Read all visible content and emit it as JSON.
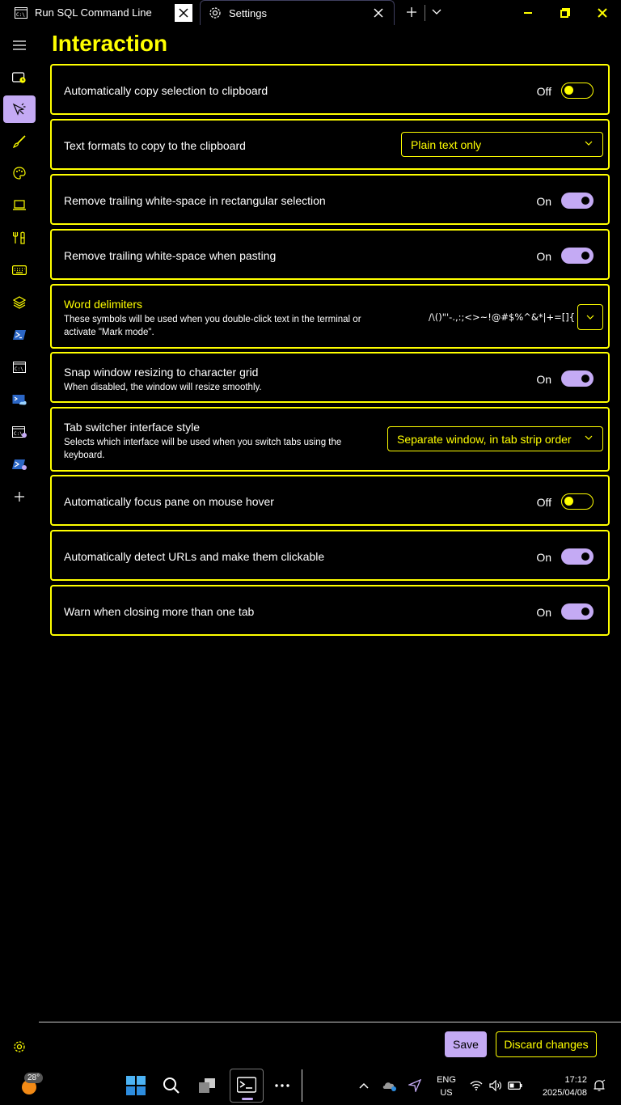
{
  "tabs": [
    {
      "title": "Run SQL Command Line",
      "icon": "cmd-icon"
    },
    {
      "title": "Settings",
      "icon": "gear-icon"
    }
  ],
  "window_controls": [
    "minimize",
    "restore",
    "close"
  ],
  "sidebar": {
    "items": [
      "menu",
      "startup",
      "interaction",
      "appearance",
      "color-schemes",
      "rendering",
      "actions",
      "keyboard",
      "layers",
      "powershell",
      "command-prompt",
      "azure-cloud-shell",
      "cmd-profile",
      "powershell-profile",
      "add-profile"
    ],
    "selected": "interaction",
    "footer": "settings"
  },
  "page": {
    "title": "Interaction"
  },
  "settings": {
    "copy_on_select": {
      "label": "Automatically copy selection to clipboard",
      "state": "Off"
    },
    "copy_formats": {
      "label": "Text formats to copy to the clipboard",
      "value": "Plain text only"
    },
    "trim_block": {
      "label": "Remove trailing white-space in rectangular selection",
      "state": "On"
    },
    "trim_paste": {
      "label": "Remove trailing white-space when pasting",
      "state": "On"
    },
    "word_delimiters": {
      "label": "Word delimiters",
      "desc": "These symbols will be used when you double-click text in the terminal or activate \"Mark mode\".",
      "value": "/\\()\"'-.,:;<>~!@#$%^&*|+=[]{}~?│"
    },
    "snap_resize": {
      "label": "Snap window resizing to character grid",
      "desc": "When disabled, the window will resize smoothly.",
      "state": "On"
    },
    "tab_switcher": {
      "label": "Tab switcher interface style",
      "desc": "Selects which interface will be used when you switch tabs using the keyboard.",
      "value": "Separate window, in tab strip order"
    },
    "focus_follow_mouse": {
      "label": "Automatically focus pane on mouse hover",
      "state": "Off"
    },
    "detect_urls": {
      "label": "Automatically detect URLs and make them clickable",
      "state": "On"
    },
    "confirm_close": {
      "label": "Warn when closing more than one tab",
      "state": "On"
    }
  },
  "actions": {
    "save": "Save",
    "discard": "Discard changes"
  },
  "taskbar": {
    "weather_temp": "28°",
    "lang_line1": "ENG",
    "lang_line2": "US",
    "time": "17:12",
    "date": "2025/04/08"
  },
  "colors": {
    "accent": "#ffff00",
    "toggle_on": "#c4aaf4",
    "background": "#000000"
  }
}
